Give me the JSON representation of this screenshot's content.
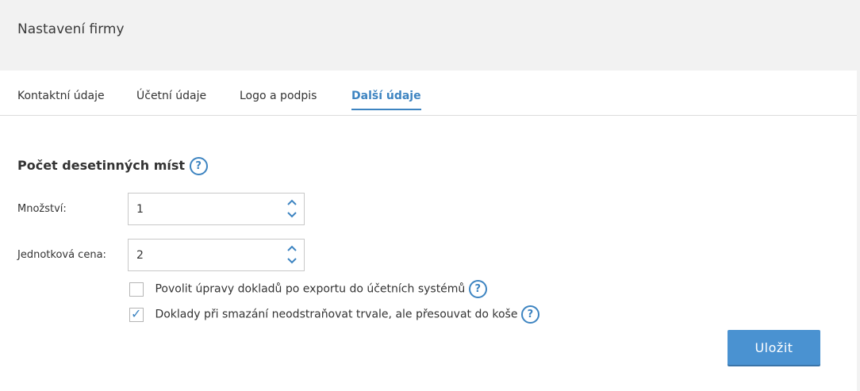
{
  "header": {
    "title": "Nastavení firmy"
  },
  "tabs": [
    {
      "label": "Kontaktní údaje",
      "active": false
    },
    {
      "label": "Účetní údaje",
      "active": false
    },
    {
      "label": "Logo a podpis",
      "active": false
    },
    {
      "label": "Další údaje",
      "active": true
    }
  ],
  "section": {
    "title": "Počet desetinných míst",
    "help": "?"
  },
  "fields": {
    "quantity": {
      "label": "Množství:",
      "value": "1"
    },
    "unit_price": {
      "label": "Jednotková cena:",
      "value": "2"
    }
  },
  "checkboxes": [
    {
      "label": "Povolit úpravy dokladů po exportu do účetních systémů",
      "checked": false,
      "help": "?"
    },
    {
      "label": "Doklady při smazání neodstraňovat trvale, ale přesouvat do koše",
      "checked": true,
      "help": "?"
    }
  ],
  "actions": {
    "save_label": "Uložit"
  },
  "colors": {
    "accent": "#3d84c1",
    "button": "#4a92d1",
    "background": "#f2f2f2"
  }
}
